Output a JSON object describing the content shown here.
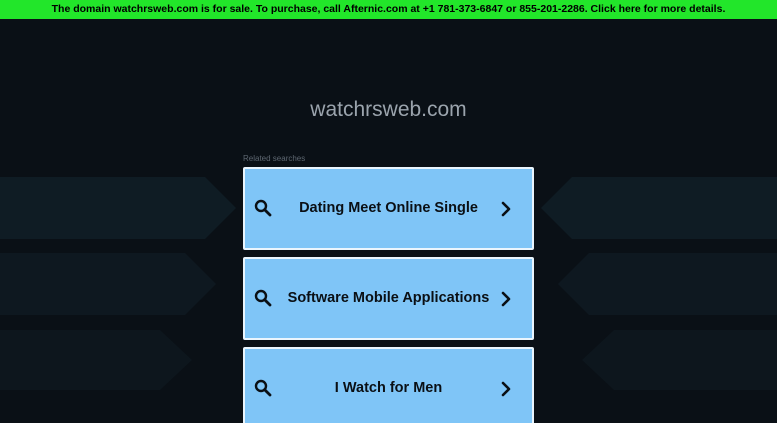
{
  "banner": {
    "text": "The domain watchrsweb.com is for sale. To purchase, call Afternic.com at +1 781-373-6847 or 855-201-2286. Click here for more details."
  },
  "domain": {
    "name": "watchrsweb.com"
  },
  "related": {
    "label": "Related searches",
    "items": [
      {
        "label": "Dating Meet Online Single"
      },
      {
        "label": "Software Mobile Applications"
      },
      {
        "label": "I Watch for Men"
      }
    ]
  },
  "colors": {
    "banner_bg": "#22e62a",
    "page_bg": "#0a1016",
    "card_bg": "#7fc5f7",
    "card_border": "#eaf5fd"
  }
}
